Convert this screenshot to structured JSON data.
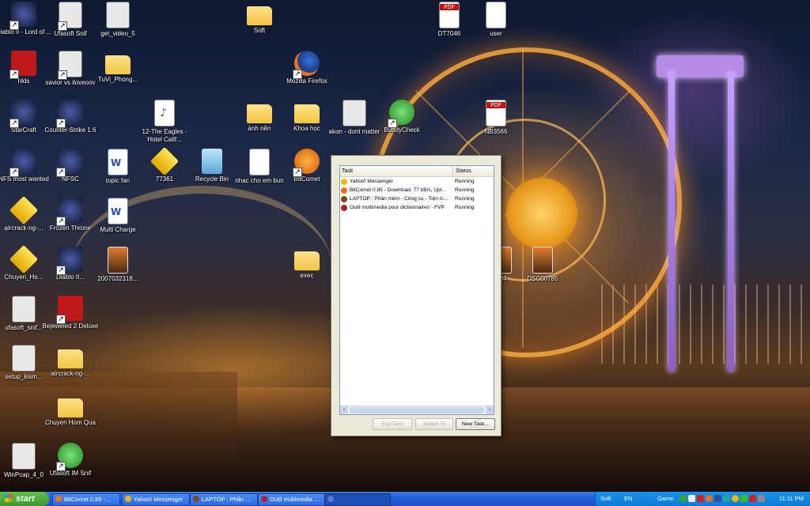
{
  "desktop_icons": [
    {
      "id": "diablo2-lord",
      "label": "Diablo II - Lord of ...",
      "type": "game",
      "icon": "diablo-icon",
      "shortcut": true
    },
    {
      "id": "ufasoft-snif",
      "label": "Ufasoft Snif",
      "type": "exe",
      "icon": "sniffer-icon",
      "shortcut": true
    },
    {
      "id": "get-video-5",
      "label": "get_video_5",
      "type": "exe",
      "icon": "file-icon",
      "shortcut": false
    },
    {
      "id": "soft-folder",
      "label": "Soft",
      "type": "folder",
      "icon": "folder-icon",
      "shortcut": false
    },
    {
      "id": "dt7046",
      "label": "DT7046",
      "type": "pdf",
      "icon": "pdf-icon",
      "shortcut": false
    },
    {
      "id": "user",
      "label": "user",
      "type": "doc",
      "icon": "document-icon",
      "shortcut": false
    },
    {
      "id": "hlds",
      "label": "hlds",
      "type": "red",
      "icon": "half-life-icon",
      "shortcut": true
    },
    {
      "id": "savior",
      "label": "savior vs iloveoov",
      "type": "exe",
      "icon": "video-icon",
      "shortcut": true
    },
    {
      "id": "tuvi",
      "label": "TuVi_Phong...",
      "type": "folder",
      "icon": "folder-icon",
      "shortcut": false
    },
    {
      "id": "firefox",
      "label": "Mozilla Firefox",
      "type": "fox",
      "icon": "firefox-icon",
      "shortcut": true
    },
    {
      "id": "starcraft",
      "label": "StarCraft",
      "type": "game",
      "icon": "starcraft-icon",
      "shortcut": true
    },
    {
      "id": "counter-strike",
      "label": "Counter-Strike 1.6",
      "type": "game",
      "icon": "counter-strike-icon",
      "shortcut": true
    },
    {
      "id": "eagles",
      "label": "12-The Eagles - Hotel Calif...",
      "type": "mp3",
      "icon": "mp3-icon",
      "shortcut": false
    },
    {
      "id": "anh-nen",
      "label": "ảnh nền",
      "type": "folder",
      "icon": "folder-icon",
      "shortcut": false
    },
    {
      "id": "khoa-hoc",
      "label": "Khoa học",
      "type": "folder",
      "icon": "folder-icon",
      "shortcut": false
    },
    {
      "id": "akon",
      "label": "akon - dont matter",
      "type": "exe",
      "icon": "media-file-icon",
      "shortcut": false
    },
    {
      "id": "buddycheck",
      "label": "BuddyCheck",
      "type": "green",
      "icon": "buddycheck-icon",
      "shortcut": true
    },
    {
      "id": "nb3566",
      "label": "NB3566",
      "type": "pdf",
      "icon": "pdf-icon",
      "shortcut": false
    },
    {
      "id": "nfs-most-wanted",
      "label": "NFS most wanted",
      "type": "game",
      "icon": "nfs-icon",
      "shortcut": true
    },
    {
      "id": "nfsc",
      "label": "NFSC",
      "type": "game",
      "icon": "nfs-carbon-icon",
      "shortcut": true
    },
    {
      "id": "topic-fan",
      "label": "topic fan",
      "type": "word",
      "icon": "word-icon",
      "shortcut": false
    },
    {
      "id": "77361",
      "label": "77361",
      "type": "yellow",
      "icon": "archive-icon",
      "shortcut": false
    },
    {
      "id": "recycle-bin",
      "label": "Recycle Bin",
      "type": "recycle",
      "icon": "recycle-bin-icon",
      "shortcut": false
    },
    {
      "id": "nhac-cho-em-bun",
      "label": "nhac cho em bun",
      "type": "doc",
      "icon": "document-icon",
      "shortcut": false
    },
    {
      "id": "bitcomet",
      "label": "BitComet",
      "type": "bit",
      "icon": "bitcomet-icon",
      "shortcut": true
    },
    {
      "id": "aircrack-1",
      "label": "aircrack-ng-...",
      "type": "yellow",
      "icon": "archive-icon",
      "shortcut": false
    },
    {
      "id": "frozen-throne",
      "label": "Frozen Throne",
      "type": "game",
      "icon": "warcraft-icon",
      "shortcut": true
    },
    {
      "id": "multi-charge",
      "label": "Multi Charge",
      "type": "word",
      "icon": "word-icon",
      "shortcut": false
    },
    {
      "id": "chuyen-ho",
      "label": "Chuyen_Ho...",
      "type": "yellow",
      "icon": "archive-icon",
      "shortcut": false
    },
    {
      "id": "diablo2",
      "label": "Diablo II...",
      "type": "game",
      "icon": "diablo-icon",
      "shortcut": true
    },
    {
      "id": "2007032318",
      "label": "2007032318...",
      "type": "photo",
      "icon": "image-file-icon",
      "shortcut": false
    },
    {
      "id": "exec",
      "label": "exec",
      "type": "folder",
      "icon": "folder-icon",
      "shortcut": false
    },
    {
      "id": "784",
      "label": "784",
      "type": "photo",
      "icon": "image-file-icon",
      "shortcut": false
    },
    {
      "id": "dsc00785",
      "label": "DSC00785",
      "type": "photo",
      "icon": "image-file-icon",
      "shortcut": false
    },
    {
      "id": "ufasoft-snif-2",
      "label": "ufasoft_snif...",
      "type": "exe",
      "icon": "installer-icon",
      "shortcut": false
    },
    {
      "id": "bejeweled",
      "label": "Bejeweled 2 Deluxe",
      "type": "red",
      "icon": "bejeweled-icon",
      "shortcut": true
    },
    {
      "id": "setup-kism",
      "label": "setup_kism...",
      "type": "exe",
      "icon": "installer-icon",
      "shortcut": false
    },
    {
      "id": "aircrack-2",
      "label": "aircrack-ng-...",
      "type": "folder",
      "icon": "folder-icon",
      "shortcut": false
    },
    {
      "id": "chuyen-hom-qua",
      "label": "Chuyen Hom Qua",
      "type": "folder",
      "icon": "folder-icon",
      "shortcut": false
    },
    {
      "id": "winpcap",
      "label": "WinPcap_4_0",
      "type": "exe",
      "icon": "installer-icon",
      "shortcut": false
    },
    {
      "id": "ufasoft-im-snif",
      "label": "Ufasoft IM Snif",
      "type": "green",
      "icon": "sniffer-icon",
      "shortcut": true
    }
  ],
  "task_window": {
    "columns": {
      "task": "Task",
      "status": "Status"
    },
    "tasks": [
      {
        "name": "Yahoo! Messenger",
        "status": "Running",
        "color": "#f2b600"
      },
      {
        "name": "BitComet 0.85 - Download: 77 kB/s, Upl...",
        "status": "Running",
        "color": "#e8731a"
      },
      {
        "name": "LAPTOP : Phần mềm - Công cụ - Tiện íc...",
        "status": "Running",
        "color": "#7a4a20"
      },
      {
        "name": "Outil multimedia pour dictionnaires - FVP",
        "status": "Running",
        "color": "#b0202a"
      }
    ],
    "buttons": {
      "end_task": "End Task",
      "switch_to": "Switch To",
      "new_task": "New Task..."
    }
  },
  "taskbar": {
    "start_label": "start",
    "items": [
      {
        "label": "BitComet 0.85 -...",
        "color": "#e8731a"
      },
      {
        "label": "Yahoo! Messenger",
        "color": "#f2b600"
      },
      {
        "label": "LAPTOP : Phần ...",
        "color": "#7a4a20"
      },
      {
        "label": "Outil multimedia ...",
        "color": "#b0202a"
      },
      {
        "label": "",
        "color": "#5a7abf"
      }
    ],
    "tray": {
      "soft": "Soft",
      "lang": "EN",
      "game": "Game",
      "clock": "11:11 PM"
    }
  }
}
